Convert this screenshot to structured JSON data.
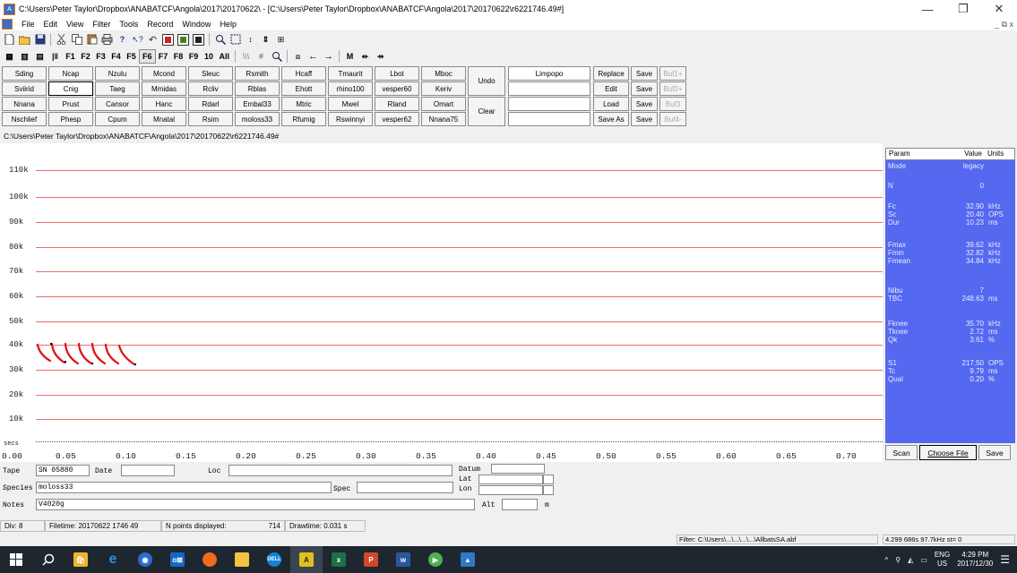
{
  "window": {
    "title": "C:\\Users\\Peter Taylor\\Dropbox\\ANABATCF\\Angola\\2017\\20170622\\ - [C:\\Users\\Peter Taylor\\Dropbox\\ANABATCF\\Angola\\2017\\20170622\\r6221746.49#]",
    "minimize": "—",
    "maximize": "❐",
    "close": "✕",
    "mdi_controls": "_  ⧉  x"
  },
  "menu": [
    "File",
    "Edit",
    "View",
    "Filter",
    "Tools",
    "Record",
    "Window",
    "Help"
  ],
  "toolbar2": {
    "fkeys": [
      "F1",
      "F2",
      "F3",
      "F4",
      "F5",
      "F6",
      "F7",
      "F8",
      "F9",
      "10",
      "All"
    ],
    "m_label": "M"
  },
  "species_keys": [
    [
      "Sding",
      "Ncap",
      "Nzulu",
      "Mcond",
      "Sleuc",
      "Rsmith",
      "Hcaff",
      "Tmaurit",
      "Lbot",
      "Mboc"
    ],
    [
      "Sviirid",
      "Cnig",
      "Taeg",
      "Mmidas",
      "Rcliv",
      "Rblas",
      "Ehott",
      "rhino100",
      "vesper60",
      "Keriv"
    ],
    [
      "Nnana",
      "Prust",
      "Cansor",
      "Hanc",
      "Rdarl",
      "Embal33",
      "Mtric",
      "Mwel",
      "Rland",
      "Omart"
    ],
    [
      "Nschlief",
      "Phesp",
      "Cpum",
      "Mnatal",
      "Rsim",
      "moloss33",
      "Rfumig",
      "Rswinnyi",
      "vesper62",
      "Nnana75"
    ]
  ],
  "key_controls": {
    "undo": "Undo",
    "clear": "Clear",
    "field1": "Limpopo",
    "replace": "Replace",
    "edit": "Edit",
    "load": "Load",
    "save_as": "Save As",
    "save": "Save",
    "bufs": [
      "Buf1+",
      "Buf2+",
      "Buf3",
      "Buf4-"
    ]
  },
  "path": "C:\\Users\\Peter Taylor\\Dropbox\\ANABATCF\\Angola\\2017\\20170622\\r6221746.49#",
  "plot": {
    "y_labels": [
      "110k",
      "100k",
      "90k",
      "80k",
      "70k",
      "60k",
      "50k",
      "40k",
      "30k",
      "20k",
      "10k"
    ],
    "x_unit_label": "secs",
    "x_labels": [
      "0.00",
      "0.05",
      "0.10",
      "0.15",
      "0.20",
      "0.25",
      "0.30",
      "0.35",
      "0.40",
      "0.45",
      "0.50",
      "0.55",
      "0.60",
      "0.65",
      "0.70"
    ],
    "line_color": "#f26b6b",
    "call_color": "#e01010"
  },
  "params": {
    "header": {
      "param": "Param",
      "value": "Value",
      "units": "Units"
    },
    "rows": [
      {
        "name": "Mode",
        "value": "legacy",
        "unit": ""
      },
      {
        "name": "N",
        "value": "0",
        "unit": ""
      },
      {
        "name": "Fc",
        "value": "32.90",
        "unit": "kHz"
      },
      {
        "name": "Sc",
        "value": "20.40",
        "unit": "OPS"
      },
      {
        "name": "Dur",
        "value": "10.23",
        "unit": "ms"
      },
      {
        "name": "Fmax",
        "value": "39.62",
        "unit": "kHz"
      },
      {
        "name": "Fmin",
        "value": "32.82",
        "unit": "kHz"
      },
      {
        "name": "Fmean",
        "value": "34.84",
        "unit": "kHz"
      },
      {
        "name": "Nibu",
        "value": "7",
        "unit": ""
      },
      {
        "name": "TBC",
        "value": "248.63",
        "unit": "ms"
      },
      {
        "name": "Fknee",
        "value": "35.70",
        "unit": "kHz"
      },
      {
        "name": "Tknee",
        "value": "2.72",
        "unit": "ms"
      },
      {
        "name": "Qk",
        "value": "3.61",
        "unit": "%"
      },
      {
        "name": "S1",
        "value": "217.50",
        "unit": "OPS"
      },
      {
        "name": "Tc",
        "value": "9.79",
        "unit": "ms"
      },
      {
        "name": "Qual",
        "value": "0.20",
        "unit": "%"
      }
    ],
    "scan": "Scan",
    "choose_file": "Choose File",
    "save": "Save"
  },
  "meta": {
    "tape_label": "Tape",
    "tape_value": "SN 05880",
    "date_label": "Date",
    "date_value": "",
    "loc_label": "Loc",
    "loc_value": "",
    "datum_label": "Datum",
    "lat_label": "Lat",
    "lon_label": "Lon",
    "species_label": "Species",
    "species_value": "moloss33",
    "spec_label": "Spec",
    "notes_label": "Notes",
    "notes_value": "V4020g",
    "alt_label": "Alt",
    "alt_unit": "m"
  },
  "status": {
    "div": "Div: 8",
    "filetime": "Filetime: 20170622 1746 49",
    "npoints_label": "N points displayed:",
    "npoints_value": "714",
    "drawtime": "Drawtime: 0.031 s",
    "filter": "Filter: C:\\Users\\...\\...\\...\\...\\AllbatsSA.abf",
    "readout": "4.299 686s  97.7kHz  st=  0"
  },
  "taskbar": {
    "lang": "ENG",
    "region": "US",
    "time": "4:29 PM",
    "date": "2017/12/30"
  }
}
